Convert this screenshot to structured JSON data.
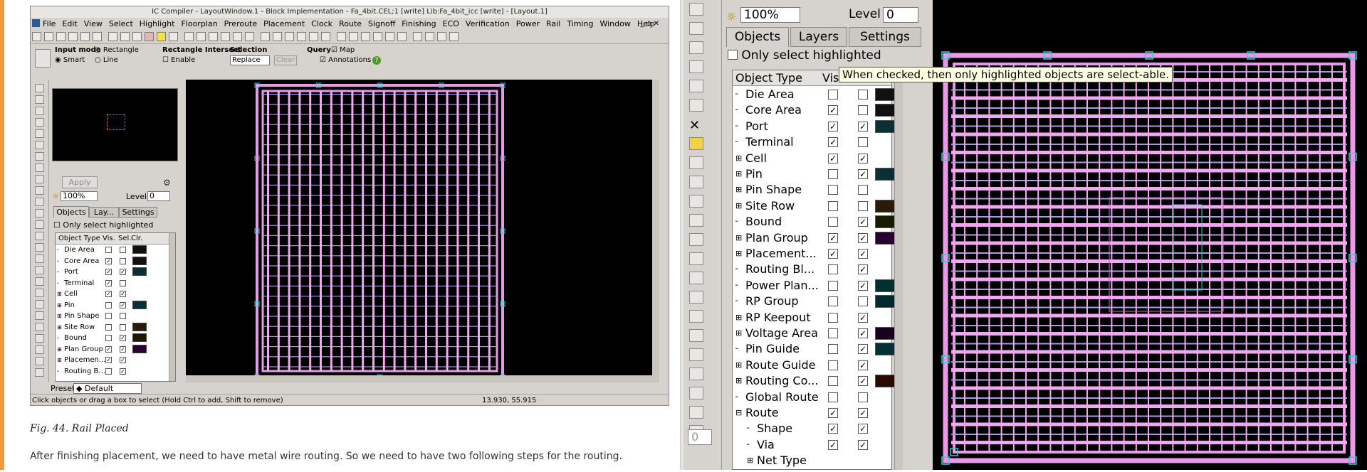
{
  "left_window": {
    "title": "IC Compiler - LayoutWindow.1 - Block Implementation - Fa_4bit.CEL;1 [write]   Lib:Fa_4bit_icc [write] - [Layout.1]",
    "menus": [
      "File",
      "Edit",
      "View",
      "Select",
      "Highlight",
      "Floorplan",
      "Preroute",
      "Placement",
      "Clock",
      "Route",
      "Signoff",
      "Finishing",
      "ECO",
      "Verification",
      "Power",
      "Rail",
      "Timing",
      "Window",
      "Help"
    ],
    "options": {
      "input_mode_label": "Input mode",
      "rectangle": "Rectangle",
      "smart": "Smart",
      "line": "Line",
      "rect_intersect_label": "Rectangle Intersect",
      "enable": "Enable",
      "selection_label": "Selection",
      "selection_value": "Replace",
      "clear": "Clear",
      "query_label": "Query",
      "map": "Map",
      "annotations": "Annotations"
    },
    "panel": {
      "apply": "Apply",
      "zoom": "100%",
      "level_label": "Level",
      "level_value": "0",
      "tabs": [
        "Objects",
        "Lay...",
        "Settings"
      ],
      "only_highlighted": "Only select highlighted",
      "headers": [
        "Object Type",
        "Vis.",
        "Sel.",
        "Clr."
      ],
      "rows": [
        {
          "name": "Die Area",
          "exp": false,
          "vis": false,
          "sel": false,
          "clr": "#111"
        },
        {
          "name": "Core Area",
          "exp": false,
          "vis": true,
          "sel": false,
          "clr": "#111"
        },
        {
          "name": "Port",
          "exp": false,
          "vis": true,
          "sel": true,
          "clr": "#0b2f36"
        },
        {
          "name": "Terminal",
          "exp": false,
          "vis": true,
          "sel": false,
          "clr": ""
        },
        {
          "name": "Cell",
          "exp": true,
          "vis": true,
          "sel": true,
          "clr": ""
        },
        {
          "name": "Pin",
          "exp": true,
          "vis": false,
          "sel": true,
          "clr": "#0b2f36"
        },
        {
          "name": "Pin Shape",
          "exp": true,
          "vis": false,
          "sel": false,
          "clr": ""
        },
        {
          "name": "Site Row",
          "exp": true,
          "vis": false,
          "sel": false,
          "clr": "#2a1a0a"
        },
        {
          "name": "Bound",
          "exp": false,
          "vis": false,
          "sel": true,
          "clr": "#1a1a00"
        },
        {
          "name": "Plan Group",
          "exp": true,
          "vis": true,
          "sel": true,
          "clr": "#2a0030"
        },
        {
          "name": "Placemen...",
          "exp": true,
          "vis": true,
          "sel": true,
          "clr": ""
        },
        {
          "name": "Routing B...",
          "exp": false,
          "vis": false,
          "sel": true,
          "clr": ""
        }
      ],
      "preset_label": "Preset",
      "preset_value": "Default"
    },
    "status_text": "Click objects or drag a box to select (Hold Ctrl to add, Shift to remove)",
    "coords": "13.930, 55.915"
  },
  "caption": "Fig. 44. Rail Placed",
  "paragraph": "After finishing placement, we need to have metal wire routing. So we need to have two following steps for the routing.",
  "right_window": {
    "zoom": "100%",
    "level_label": "Level",
    "level_value": "0",
    "tabs": [
      "Objects",
      "Layers",
      "Settings"
    ],
    "only_highlighted": "Only select highlighted",
    "tooltip": "When checked, then only highlighted objects are select-able.",
    "headers": [
      "Object Type",
      "Vis"
    ],
    "rows": [
      {
        "name": "Die Area",
        "exp": false,
        "indent": 0,
        "vis": false,
        "sel": false,
        "clr": "#111"
      },
      {
        "name": "Core Area",
        "exp": false,
        "indent": 0,
        "vis": true,
        "sel": false,
        "clr": "#111"
      },
      {
        "name": "Port",
        "exp": false,
        "indent": 0,
        "vis": true,
        "sel": true,
        "clr": "#0b2f36"
      },
      {
        "name": "Terminal",
        "exp": false,
        "indent": 0,
        "vis": true,
        "sel": false,
        "clr": ""
      },
      {
        "name": "Cell",
        "exp": true,
        "indent": 0,
        "vis": true,
        "sel": true,
        "clr": ""
      },
      {
        "name": "Pin",
        "exp": true,
        "indent": 0,
        "vis": false,
        "sel": true,
        "clr": "#0b2f36"
      },
      {
        "name": "Pin Shape",
        "exp": true,
        "indent": 0,
        "vis": false,
        "sel": false,
        "clr": ""
      },
      {
        "name": "Site Row",
        "exp": true,
        "indent": 0,
        "vis": false,
        "sel": false,
        "clr": "#2a1a0a"
      },
      {
        "name": "Bound",
        "exp": false,
        "indent": 0,
        "vis": false,
        "sel": true,
        "clr": "#1a1a00"
      },
      {
        "name": "Plan Group",
        "exp": true,
        "indent": 0,
        "vis": true,
        "sel": true,
        "clr": "#2a0030"
      },
      {
        "name": "Placement...",
        "exp": true,
        "indent": 0,
        "vis": true,
        "sel": true,
        "clr": ""
      },
      {
        "name": "Routing Bl...",
        "exp": false,
        "indent": 0,
        "vis": false,
        "sel": true,
        "clr": ""
      },
      {
        "name": "Power Plan...",
        "exp": false,
        "indent": 0,
        "vis": false,
        "sel": true,
        "clr": "#003030"
      },
      {
        "name": "RP Group",
        "exp": false,
        "indent": 0,
        "vis": false,
        "sel": false,
        "clr": "#002a30"
      },
      {
        "name": "RP Keepout",
        "exp": true,
        "indent": 0,
        "vis": false,
        "sel": true,
        "clr": ""
      },
      {
        "name": "Voltage Area",
        "exp": true,
        "indent": 0,
        "vis": false,
        "sel": true,
        "clr": "#1a0020"
      },
      {
        "name": "Pin Guide",
        "exp": false,
        "indent": 0,
        "vis": false,
        "sel": true,
        "clr": "#003036"
      },
      {
        "name": "Route Guide",
        "exp": true,
        "indent": 0,
        "vis": false,
        "sel": true,
        "clr": ""
      },
      {
        "name": "Routing Co...",
        "exp": true,
        "indent": 0,
        "vis": false,
        "sel": true,
        "clr": "#2a0a00"
      },
      {
        "name": "Global Route",
        "exp": false,
        "indent": 0,
        "vis": false,
        "sel": false,
        "clr": ""
      },
      {
        "name": "Route",
        "exp": "open",
        "indent": 0,
        "vis": true,
        "sel": true,
        "clr": ""
      },
      {
        "name": "Shape",
        "exp": false,
        "indent": 1,
        "vis": true,
        "sel": true,
        "clr": ""
      },
      {
        "name": "Via",
        "exp": false,
        "indent": 1,
        "vis": true,
        "sel": true,
        "clr": ""
      },
      {
        "name": "Net Type",
        "exp": true,
        "indent": 1,
        "vis": false,
        "sel": false,
        "clr": "",
        "hide_checks": true
      }
    ]
  }
}
